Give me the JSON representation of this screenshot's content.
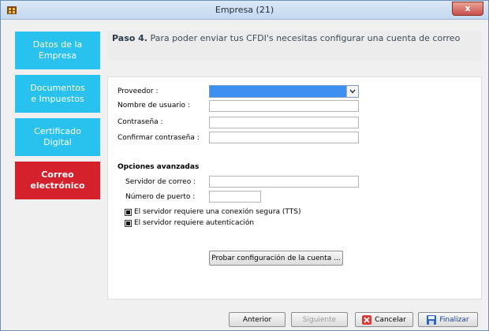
{
  "window": {
    "title": "Empresa (21)",
    "close_label": "x"
  },
  "sidebar": {
    "items": [
      {
        "label_line1": "Datos de la",
        "label_line2": "Empresa"
      },
      {
        "label_line1": "Documentos",
        "label_line2": "e Impuestos"
      },
      {
        "label_line1": "Certificado",
        "label_line2": "Digital"
      },
      {
        "label_line1": "Correo",
        "label_line2": "electrónico"
      }
    ]
  },
  "step": {
    "prefix": "Paso 4.",
    "text": "Para poder enviar tus CFDI's necesitas configurar una cuenta de correo"
  },
  "form": {
    "provider_label": "Proveedor :",
    "provider_value": "",
    "username_label": "Nombre de usuario :",
    "username_value": "",
    "password_label": "Contraseña :",
    "confirm_label": "Confirmar contraseña :",
    "advanced_heading": "Opciones avanzadas",
    "server_label": "Servidor de correo :",
    "server_value": "",
    "port_label": "Número de puerto :",
    "port_value": "",
    "secure_label": "El servidor requiere una conexión segura (TTS)",
    "auth_label": "El servidor requiere autenticación",
    "test_button": "Probar configuración de la cuenta ..."
  },
  "footer": {
    "back": "Anterior",
    "next": "Siguiente",
    "cancel": "Cancelar",
    "finish": "Finalizar"
  },
  "colors": {
    "nav_inactive": "#29c2ee",
    "nav_active": "#d5212b",
    "select_highlight": "#3d8ff2"
  }
}
